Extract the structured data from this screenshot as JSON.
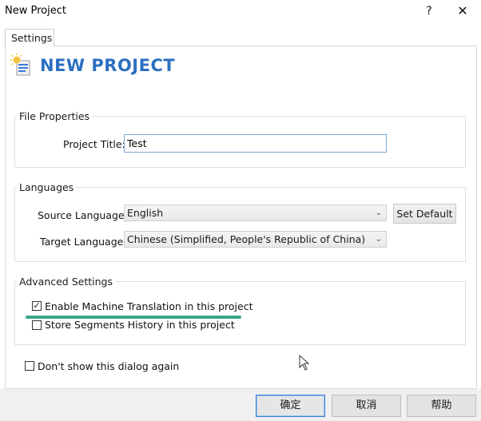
{
  "window": {
    "title": "New Project",
    "help_label": "?",
    "close_label": "✕"
  },
  "tab": {
    "label": "Settings"
  },
  "header": {
    "title": "NEW PROJECT"
  },
  "file_properties": {
    "legend": "File Properties",
    "project_title_label": "Project Title:",
    "project_title_value": "Test"
  },
  "languages": {
    "legend": "Languages",
    "source_label": "Source Language:",
    "source_value": "English",
    "target_label": "Target Language:",
    "target_value": "Chinese (Simplified, People's Republic of China)",
    "set_default_label": "Set Default"
  },
  "advanced": {
    "legend": "Advanced Settings",
    "machine_translation_label": "Enable Machine Translation in this project",
    "machine_translation_checked": true,
    "segments_history_label": "Store Segments History in this project",
    "segments_history_checked": false
  },
  "dont_show": {
    "label": "Don't show this dialog again",
    "checked": false
  },
  "footer": {
    "ok_label": "确定",
    "cancel_label": "取消",
    "help_label": "帮助"
  },
  "colors": {
    "heading": "#2b6fc0",
    "highlight": "#3aa58a",
    "primary_border": "#3b7ddc"
  }
}
